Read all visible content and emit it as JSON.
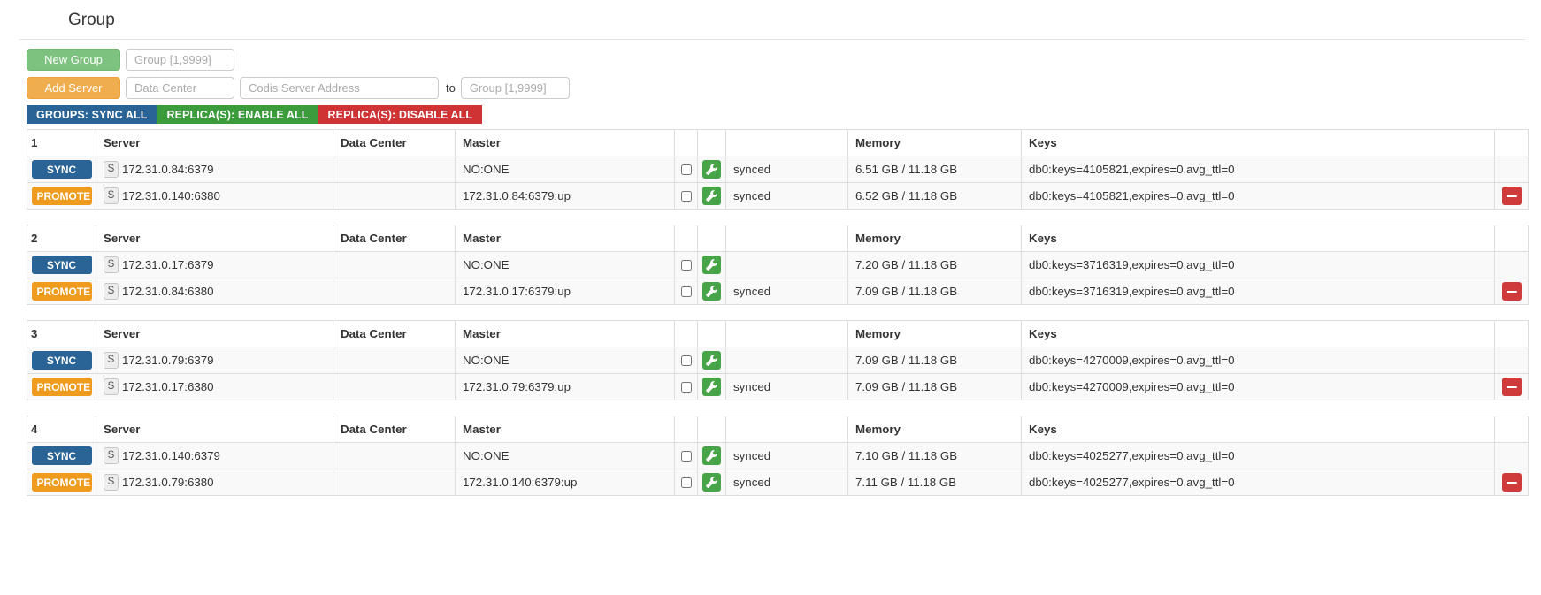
{
  "header": {
    "title": "Group"
  },
  "toolbar": {
    "new_group_label": "New Group",
    "new_group_placeholder": "Group [1,9999]",
    "add_server_label": "Add Server",
    "data_center_placeholder": "Data Center",
    "server_address_placeholder": "Codis Server Address",
    "to_label": "to",
    "to_group_placeholder": "Group [1,9999]",
    "new_group_value": "",
    "data_center_value": "",
    "server_address_value": "",
    "to_group_value": ""
  },
  "bulk_actions": [
    {
      "label": "GROUPS: SYNC ALL",
      "color": "#2a6496",
      "name": "groups-sync-all-button"
    },
    {
      "label": "REPLICA(S): ENABLE ALL",
      "color": "#3c9c3c",
      "name": "replicas-enable-all-button"
    },
    {
      "label": "REPLICA(S): DISABLE ALL",
      "color": "#cf3333",
      "name": "replicas-disable-all-button"
    }
  ],
  "columns": {
    "server": "Server",
    "data_center": "Data Center",
    "master": "Master",
    "memory": "Memory",
    "keys": "Keys"
  },
  "groups": [
    {
      "id": "1",
      "rows": [
        {
          "action": "SYNC",
          "action_type": "sync",
          "role_badge": "S",
          "server": "172.31.0.84:6379",
          "data_center": "",
          "master": "NO:ONE",
          "checked": false,
          "state": "synced",
          "memory": "6.51 GB / 11.18 GB",
          "keys": "db0:keys=4105821,expires=0,avg_ttl=0",
          "deletable": false
        },
        {
          "action": "PROMOTE",
          "action_type": "promote",
          "role_badge": "S",
          "server": "172.31.0.140:6380",
          "data_center": "",
          "master": "172.31.0.84:6379:up",
          "checked": false,
          "state": "synced",
          "memory": "6.52 GB / 11.18 GB",
          "keys": "db0:keys=4105821,expires=0,avg_ttl=0",
          "deletable": true
        }
      ]
    },
    {
      "id": "2",
      "rows": [
        {
          "action": "SYNC",
          "action_type": "sync",
          "role_badge": "S",
          "server": "172.31.0.17:6379",
          "data_center": "",
          "master": "NO:ONE",
          "checked": false,
          "state": "",
          "memory": "7.20 GB / 11.18 GB",
          "keys": "db0:keys=3716319,expires=0,avg_ttl=0",
          "deletable": false
        },
        {
          "action": "PROMOTE",
          "action_type": "promote",
          "role_badge": "S",
          "server": "172.31.0.84:6380",
          "data_center": "",
          "master": "172.31.0.17:6379:up",
          "checked": false,
          "state": "synced",
          "memory": "7.09 GB / 11.18 GB",
          "keys": "db0:keys=3716319,expires=0,avg_ttl=0",
          "deletable": true
        }
      ]
    },
    {
      "id": "3",
      "rows": [
        {
          "action": "SYNC",
          "action_type": "sync",
          "role_badge": "S",
          "server": "172.31.0.79:6379",
          "data_center": "",
          "master": "NO:ONE",
          "checked": false,
          "state": "",
          "memory": "7.09 GB / 11.18 GB",
          "keys": "db0:keys=4270009,expires=0,avg_ttl=0",
          "deletable": false
        },
        {
          "action": "PROMOTE",
          "action_type": "promote",
          "role_badge": "S",
          "server": "172.31.0.17:6380",
          "data_center": "",
          "master": "172.31.0.79:6379:up",
          "checked": false,
          "state": "synced",
          "memory": "7.09 GB / 11.18 GB",
          "keys": "db0:keys=4270009,expires=0,avg_ttl=0",
          "deletable": true
        }
      ]
    },
    {
      "id": "4",
      "rows": [
        {
          "action": "SYNC",
          "action_type": "sync",
          "role_badge": "S",
          "server": "172.31.0.140:6379",
          "data_center": "",
          "master": "NO:ONE",
          "checked": false,
          "state": "synced",
          "memory": "7.10 GB / 11.18 GB",
          "keys": "db0:keys=4025277,expires=0,avg_ttl=0",
          "deletable": false
        },
        {
          "action": "PROMOTE",
          "action_type": "promote",
          "role_badge": "S",
          "server": "172.31.0.79:6380",
          "data_center": "",
          "master": "172.31.0.140:6379:up",
          "checked": false,
          "state": "synced",
          "memory": "7.11 GB / 11.18 GB",
          "keys": "db0:keys=4025277,expires=0,avg_ttl=0",
          "deletable": true
        }
      ]
    }
  ],
  "icons": {
    "wrench": "wrench-icon",
    "minus": "minus-icon",
    "role_badge": "slave-role-badge"
  },
  "colors": {
    "sync_blue": "#2a6496",
    "promote_orange": "#ef9b1e",
    "wrench_green": "#48a448",
    "delete_red": "#cf3b3b",
    "new_group_green": "#7dc37f",
    "add_server_orange": "#f0ad4e"
  }
}
